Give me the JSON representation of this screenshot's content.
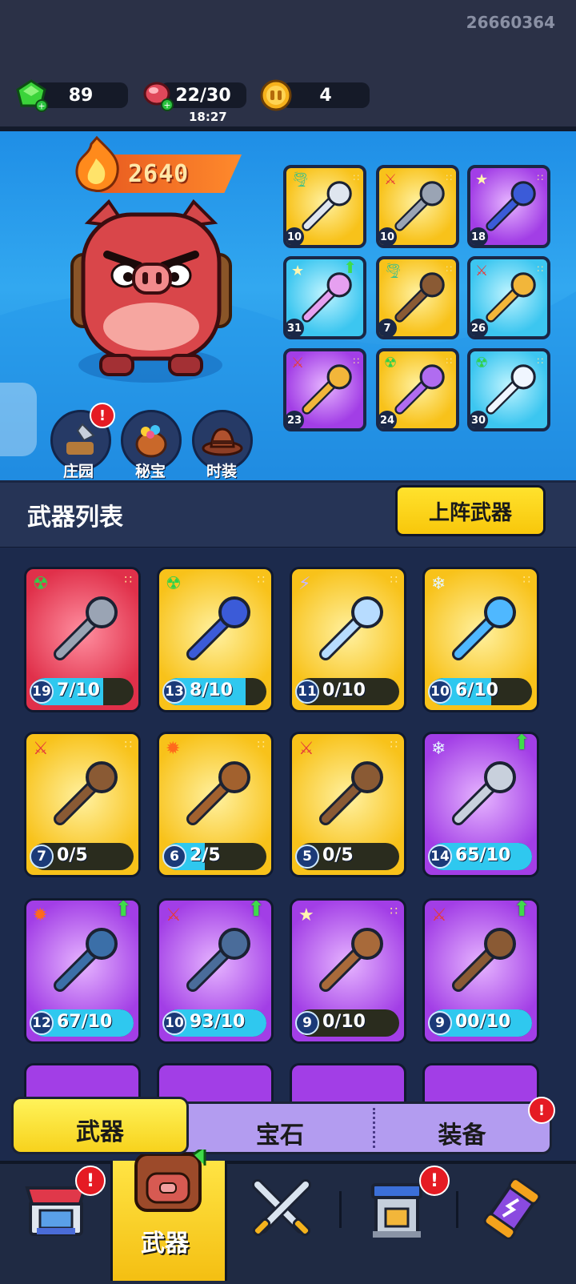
{
  "header": {
    "player_id": "26660364",
    "gems": "89",
    "stamina": "22/30",
    "stamina_timer": "18:27",
    "coins": "4"
  },
  "hero": {
    "power": "2640",
    "nav": [
      {
        "label": "庄园",
        "badge": "!"
      },
      {
        "label": "秘宝"
      },
      {
        "label": "时装"
      }
    ],
    "equipped": [
      {
        "level": "10",
        "rarity": "gold",
        "tag": "tornado-icon",
        "item": "feather-fan"
      },
      {
        "level": "10",
        "rarity": "gold",
        "tag": "sword-icon",
        "item": "axe"
      },
      {
        "level": "18",
        "rarity": "purple",
        "tag": "star-icon",
        "item": "wizard-hat"
      },
      {
        "level": "31",
        "rarity": "blue",
        "tag": "star-icon",
        "item": "gem-glove",
        "upgrade": true
      },
      {
        "level": "7",
        "rarity": "gold",
        "tag": "tornado-icon",
        "item": "rock"
      },
      {
        "level": "26",
        "rarity": "blue",
        "tag": "sword-icon",
        "item": "dagger"
      },
      {
        "level": "23",
        "rarity": "purple",
        "tag": "sword-icon",
        "item": "bow"
      },
      {
        "level": "24",
        "rarity": "gold",
        "tag": "poison-icon",
        "item": "dino-blade"
      },
      {
        "level": "30",
        "rarity": "blue",
        "tag": "poison-icon",
        "item": "crystal-lance"
      }
    ]
  },
  "weapon_list": {
    "title": "武器列表",
    "deploy_button": "上阵武器",
    "weapons": [
      {
        "level": "19",
        "count": "7/10",
        "fill": 0.7,
        "rarity": "red",
        "tag": "poison-icon",
        "item": "tombstone-shrine"
      },
      {
        "level": "13",
        "count": "8/10",
        "fill": 0.8,
        "rarity": "gold",
        "tag": "poison-icon",
        "item": "spear"
      },
      {
        "level": "11",
        "count": "0/10",
        "fill": 0,
        "rarity": "gold",
        "tag": "lightning-icon",
        "item": "mace-staff"
      },
      {
        "level": "10",
        "count": "6/10",
        "fill": 0.6,
        "rarity": "gold",
        "tag": "snowflake-icon",
        "item": "ice-crystal"
      },
      {
        "level": "7",
        "count": "0/5",
        "fill": 0,
        "rarity": "gold",
        "tag": "sword-icon",
        "item": "hammer"
      },
      {
        "level": "6",
        "count": "2/5",
        "fill": 0.4,
        "rarity": "gold",
        "tag": "fire-icon",
        "item": "horn"
      },
      {
        "level": "5",
        "count": "0/5",
        "fill": 0,
        "rarity": "gold",
        "tag": "sword-icon",
        "item": "pistol"
      },
      {
        "level": "14",
        "count": "65/10",
        "fill": 1,
        "rarity": "purple",
        "tag": "snowflake-icon",
        "item": "flail",
        "upgrade": true
      },
      {
        "level": "12",
        "count": "67/10",
        "fill": 1,
        "rarity": "purple",
        "tag": "fire-icon",
        "item": "spellbook",
        "upgrade": true
      },
      {
        "level": "10",
        "count": "93/10",
        "fill": 1,
        "rarity": "purple",
        "tag": "sword-icon",
        "item": "crossbow",
        "upgrade": true
      },
      {
        "level": "9",
        "count": "0/10",
        "fill": 0,
        "rarity": "purple",
        "tag": "star-icon",
        "item": "wooden-shield"
      },
      {
        "level": "9",
        "count": "00/10",
        "fill": 1,
        "rarity": "purple",
        "tag": "sword-icon",
        "item": "rake",
        "upgrade": true
      }
    ]
  },
  "tabs": {
    "weapon": "武器",
    "gem": "宝石",
    "gear": "装备",
    "gear_badge": "!"
  },
  "bottom_nav": {
    "active_label": "武器",
    "shop_badge": "!",
    "building_badge": "!"
  },
  "colors": {
    "gold": "#f8c21a",
    "purple": "#a23ee6",
    "blue": "#3cc6f0",
    "red": "#e0304a",
    "badge": "#e51b23",
    "progress": "#2fc8ef"
  }
}
